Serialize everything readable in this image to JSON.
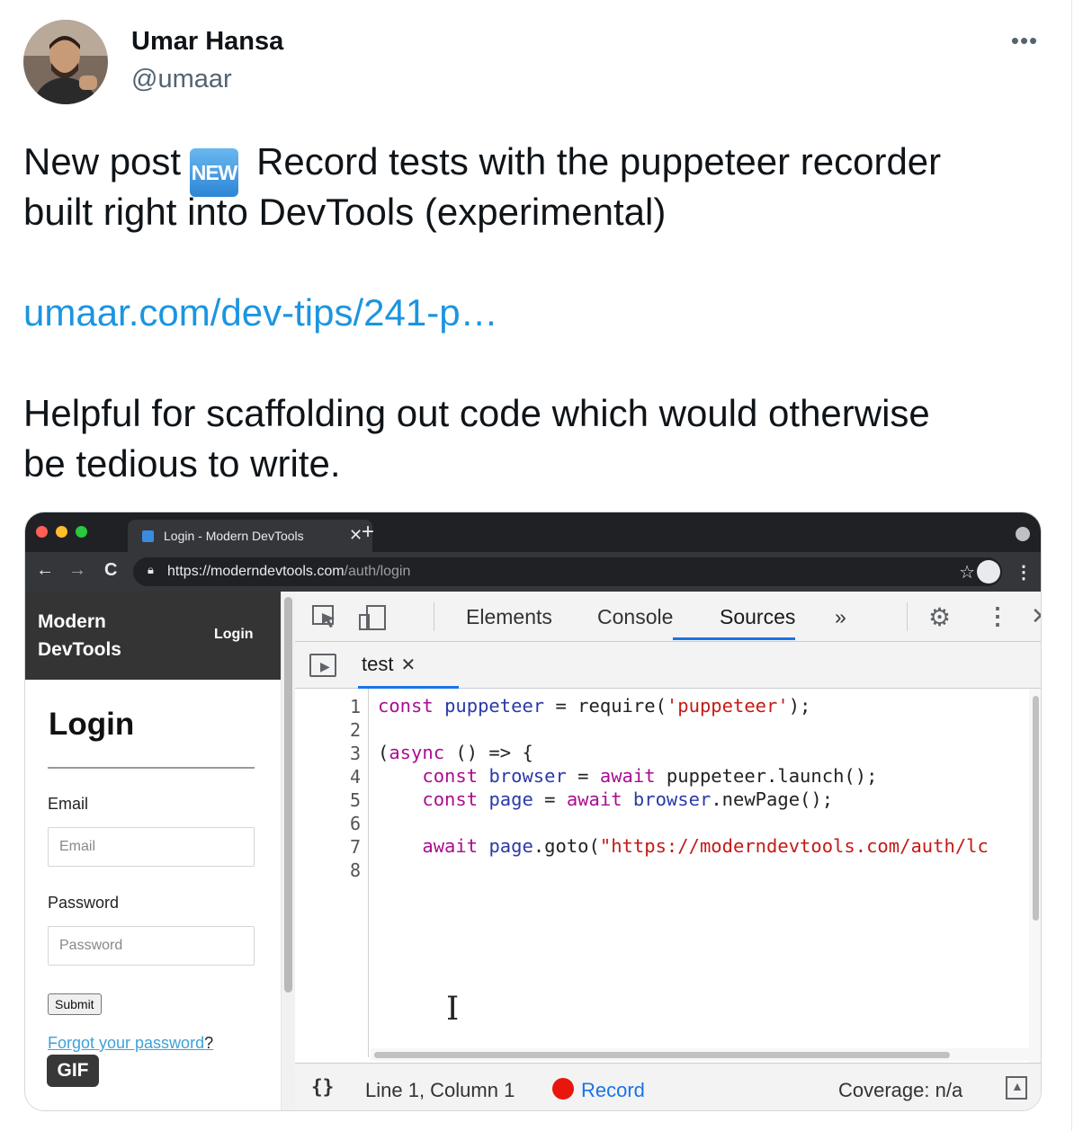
{
  "author": {
    "name": "Umar Hansa",
    "handle": "@umaar"
  },
  "tweet": {
    "line1_before": "New post",
    "badge": "NEW",
    "line1_after": "Record tests with the puppeteer recorder",
    "line2": "built right into DevTools (experimental)",
    "link": "umaar.com/dev-tips/241-p…",
    "line3": "Helpful for scaffolding out code which would otherwise",
    "line4": "be tedious to write."
  },
  "more_label": "•••",
  "browser": {
    "tab_title": "Login - Modern DevTools",
    "tab_close": "✕",
    "new_tab": "+",
    "back": "←",
    "forward": "→",
    "reload": "C",
    "url_host": "https://moderndevtools.com",
    "url_path": "/auth/login"
  },
  "page": {
    "brand": "Modern DevTools",
    "nav_login": "Login",
    "heading": "Login",
    "email_label": "Email",
    "email_placeholder": "Email",
    "password_label": "Password",
    "password_placeholder": "Password",
    "submit": "Submit",
    "forgot": "Forgot your password",
    "forgot_q": "?"
  },
  "gif_badge": "GIF",
  "devtools": {
    "tabs": [
      "Elements",
      "Console",
      "Sources"
    ],
    "active_tab": "Sources",
    "more_tabs": "»",
    "close": "✕",
    "file_tab": "test",
    "file_close": "✕",
    "line_numbers": [
      "1",
      "2",
      "3",
      "4",
      "5",
      "6",
      "7",
      "8"
    ],
    "code": [
      "const puppeteer = require('puppeteer');",
      "",
      "(async () => {",
      "    const browser = await puppeteer.launch();",
      "    const page = await browser.newPage();",
      "",
      "    await page.goto(\"https://moderndevtools.com/auth/lc",
      ""
    ],
    "status": {
      "pretty_print": "{}",
      "position": "Line 1, Column 1",
      "record": "Record",
      "coverage": "Coverage: n/a"
    }
  },
  "colors": {
    "link": "#1b95e0",
    "record_dot": "#e8160c",
    "active_tab_underline": "#1a73e8"
  }
}
